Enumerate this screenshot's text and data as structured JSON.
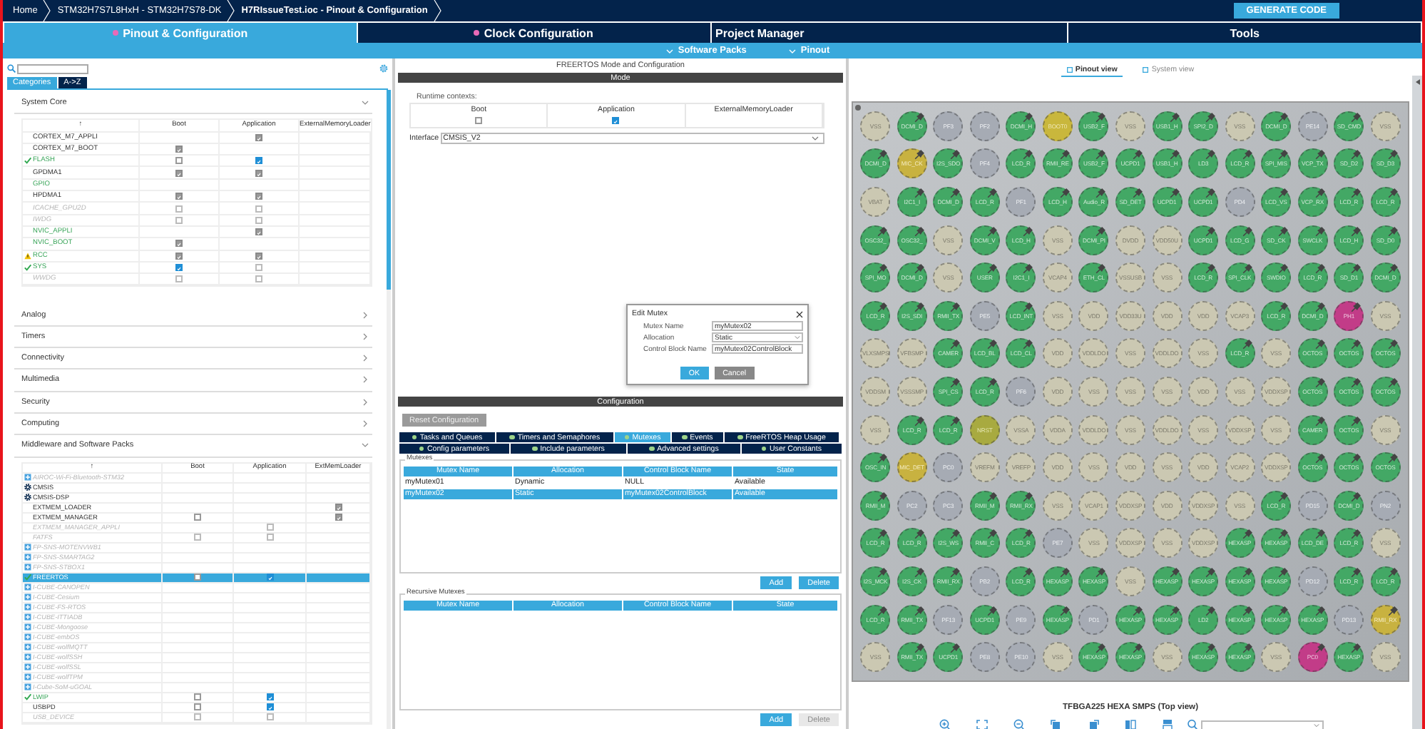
{
  "breadcrumbs": [
    "Home",
    "STM32H7S7L8HxH  -  STM32H7S78-DK",
    "H7RIssueTest.ioc - Pinout & Configuration"
  ],
  "generate_button": "GENERATE CODE",
  "tabs": [
    {
      "label": "Pinout & Configuration",
      "selected": true,
      "modified": true
    },
    {
      "label": "Clock Configuration",
      "selected": false,
      "modified": true
    },
    {
      "label": "Project Manager",
      "selected": false,
      "modified": false
    },
    {
      "label": "Tools",
      "selected": false,
      "modified": false
    }
  ],
  "menus": [
    "Software Packs",
    "Pinout"
  ],
  "sidebar": {
    "view_tabs": [
      {
        "label": "Categories",
        "selected": true
      },
      {
        "label": "A->Z",
        "selected": false
      }
    ],
    "groups": [
      {
        "title": "System Core",
        "expanded": true,
        "columns": [
          "↑",
          "Boot",
          "Application",
          "ExternalMemoryLoader"
        ],
        "rows": [
          {
            "name": "CORTEX_M7_APPLI",
            "kind": "available",
            "application": {
              "checked": true,
              "enabled": false
            }
          },
          {
            "name": "CORTEX_M7_BOOT",
            "kind": "available",
            "boot": {
              "checked": true,
              "enabled": false
            }
          },
          {
            "name": "FLASH",
            "kind": "ok",
            "boot": {
              "checked": false,
              "enabled": true
            },
            "application": {
              "checked": true,
              "enabled": true
            }
          },
          {
            "name": "GPDMA1",
            "kind": "available",
            "boot": {
              "checked": true,
              "enabled": false
            },
            "application": {
              "checked": true,
              "enabled": false
            }
          },
          {
            "name": "GPIO",
            "kind": "configured"
          },
          {
            "name": "HPDMA1",
            "kind": "available",
            "boot": {
              "checked": true,
              "enabled": false
            },
            "application": {
              "checked": true,
              "enabled": false
            }
          },
          {
            "name": "ICACHE_GPU2D",
            "kind": "unavailable",
            "boot": {
              "checked": false,
              "enabled": false
            },
            "application": {
              "checked": false,
              "enabled": false
            }
          },
          {
            "name": "IWDG",
            "kind": "unavailable",
            "boot": {
              "checked": false,
              "enabled": false
            },
            "application": {
              "checked": false,
              "enabled": false
            }
          },
          {
            "name": "NVIC_APPLI",
            "kind": "configured",
            "application": {
              "checked": true,
              "enabled": false
            }
          },
          {
            "name": "NVIC_BOOT",
            "kind": "configured",
            "boot": {
              "checked": true,
              "enabled": false
            }
          },
          {
            "name": "RCC",
            "kind": "warning",
            "boot": {
              "checked": true,
              "enabled": false
            },
            "application": {
              "checked": true,
              "enabled": false
            }
          },
          {
            "name": "SYS",
            "kind": "ok",
            "boot": {
              "checked": true,
              "enabled": true
            },
            "application": {
              "checked": false,
              "enabled": false
            }
          },
          {
            "name": "WWDG",
            "kind": "unavailable",
            "boot": {
              "checked": false,
              "enabled": false
            },
            "application": {
              "checked": false,
              "enabled": false
            }
          }
        ]
      },
      {
        "title": "Analog",
        "expanded": false
      },
      {
        "title": "Timers",
        "expanded": false
      },
      {
        "title": "Connectivity",
        "expanded": false
      },
      {
        "title": "Multimedia",
        "expanded": false
      },
      {
        "title": "Security",
        "expanded": false
      },
      {
        "title": "Computing",
        "expanded": false
      },
      {
        "title": "Middleware and Software Packs",
        "expanded": true,
        "columns": [
          "↑",
          "Boot",
          "Application",
          "ExtMemLoader"
        ],
        "rows": [
          {
            "name": "AIROC-Wi-Fi-Bluetooth-STM32",
            "kind": "pack",
            "selected": false
          },
          {
            "name": "CMSIS",
            "kind": "component",
            "selected": false
          },
          {
            "name": "CMSIS-DSP",
            "kind": "component",
            "selected": false
          },
          {
            "name": "EXTMEM_LOADER",
            "kind": "available",
            "selected": false,
            "ext": {
              "checked": true,
              "enabled": false
            }
          },
          {
            "name": "EXTMEM_MANAGER",
            "kind": "available",
            "selected": false,
            "boot": {
              "checked": false,
              "enabled": true
            },
            "ext": {
              "checked": true,
              "enabled": false
            }
          },
          {
            "name": "EXTMEM_MANAGER_APPLI",
            "kind": "unavailable",
            "selected": false,
            "application": {
              "checked": false,
              "enabled": false
            }
          },
          {
            "name": "FATFS",
            "kind": "unavailable",
            "selected": false,
            "boot": {
              "checked": false,
              "enabled": false
            },
            "application": {
              "checked": false,
              "enabled": false
            }
          },
          {
            "name": "FP-SNS-MOTENVWB1",
            "kind": "pack",
            "selected": false
          },
          {
            "name": "FP-SNS-SMARTAG2",
            "kind": "pack",
            "selected": false
          },
          {
            "name": "FP-SNS-STBOX1",
            "kind": "pack",
            "selected": false
          },
          {
            "name": "FREERTOS",
            "kind": "ok",
            "selected": true,
            "boot": {
              "checked": false,
              "enabled": true
            },
            "application": {
              "checked": true,
              "enabled": true
            }
          },
          {
            "name": "I-CUBE-CANOPEN",
            "kind": "pack",
            "selected": false
          },
          {
            "name": "I-CUBE-Cesium",
            "kind": "pack",
            "selected": false
          },
          {
            "name": "I-CUBE-FS-RTOS",
            "kind": "pack",
            "selected": false
          },
          {
            "name": "I-CUBE-ITTIADB",
            "kind": "pack",
            "selected": false
          },
          {
            "name": "I-CUBE-Mongoose",
            "kind": "pack",
            "selected": false
          },
          {
            "name": "I-CUBE-embOS",
            "kind": "pack",
            "selected": false
          },
          {
            "name": "I-CUBE-wolfMQTT",
            "kind": "pack",
            "selected": false
          },
          {
            "name": "I-CUBE-wolfSSH",
            "kind": "pack",
            "selected": false
          },
          {
            "name": "I-CUBE-wolfSSL",
            "kind": "pack",
            "selected": false
          },
          {
            "name": "I-CUBE-wolfTPM",
            "kind": "pack",
            "selected": false
          },
          {
            "name": "I-Cube-SoM-uGOAL",
            "kind": "pack",
            "selected": false
          },
          {
            "name": "LWIP",
            "kind": "ok",
            "selected": false,
            "boot": {
              "checked": false,
              "enabled": true
            },
            "application": {
              "checked": true,
              "enabled": true
            }
          },
          {
            "name": "USBPD",
            "kind": "available",
            "selected": false,
            "boot": {
              "checked": false,
              "enabled": true
            },
            "application": {
              "checked": true,
              "enabled": true
            }
          },
          {
            "name": "USB_DEVICE",
            "kind": "unavailable",
            "selected": false,
            "boot": {
              "checked": false,
              "enabled": false
            },
            "application": {
              "checked": false,
              "enabled": false
            }
          }
        ]
      }
    ]
  },
  "mode_panel": {
    "title": "FREERTOS Mode and Configuration",
    "section": "Mode",
    "runtime_label": "Runtime contexts:",
    "contexts": [
      {
        "label": "Boot",
        "checked": false
      },
      {
        "label": "Application",
        "checked": true
      },
      {
        "label": "ExternalMemoryLoader"
      }
    ],
    "interface": {
      "label": "Interface",
      "value": "CMSIS_V2"
    }
  },
  "dialog": {
    "title": "Edit Mutex",
    "fields": [
      {
        "label": "Mutex Name",
        "kind": "text",
        "value": "myMutex02"
      },
      {
        "label": "Allocation",
        "kind": "select",
        "value": "Static"
      },
      {
        "label": "Control Block Name",
        "kind": "text",
        "value": "myMutex02ControlBlock"
      }
    ],
    "buttons": [
      {
        "label": "OK",
        "kind": "primary"
      },
      {
        "label": "Cancel",
        "kind": "secondary"
      }
    ]
  },
  "config_panel": {
    "section": "Configuration",
    "reset_button": "Reset Configuration",
    "tab_rows": [
      [
        {
          "label": "Tasks and Queues",
          "selected": false
        },
        {
          "label": "Timers and Semaphores",
          "selected": false
        },
        {
          "label": "Mutexes",
          "selected": true
        },
        {
          "label": "Events",
          "selected": false
        },
        {
          "label": "FreeRTOS Heap Usage",
          "selected": false
        }
      ],
      [
        {
          "label": "Config parameters",
          "selected": false
        },
        {
          "label": "Include parameters",
          "selected": false
        },
        {
          "label": "Advanced settings",
          "selected": false
        },
        {
          "label": "User Constants",
          "selected": false
        }
      ]
    ],
    "tables": [
      {
        "title": "Mutexes",
        "columns": [
          "Mutex Name",
          "Allocation",
          "Control Block Name",
          "State"
        ],
        "rows": [
          {
            "cells": [
              "myMutex01",
              "Dynamic",
              "NULL",
              "Available"
            ],
            "selected": false
          },
          {
            "cells": [
              "myMutex02",
              "Static",
              "myMutex02ControlBlock",
              "Available"
            ],
            "selected": true
          }
        ],
        "buttons": [
          {
            "label": "Add",
            "disabled": false
          },
          {
            "label": "Delete",
            "disabled": false
          }
        ]
      },
      {
        "title": "Recursive Mutexes",
        "columns": [
          "Mutex Name",
          "Allocation",
          "Control Block Name",
          "State"
        ],
        "buttons": [
          {
            "label": "Add",
            "disabled": false
          },
          {
            "label": "Delete",
            "disabled": true
          }
        ]
      }
    ]
  },
  "pinout": {
    "view_tabs": [
      {
        "label": "Pinout view",
        "selected": true
      },
      {
        "label": "System view",
        "selected": false
      }
    ],
    "pins": [
      [
        {
          "label": "VSS",
          "kind": "power",
          "pinned": false
        },
        {
          "label": "DCMI_D",
          "kind": "signal",
          "pinned": true
        },
        {
          "label": "PF3",
          "kind": "io",
          "pinned": false
        },
        {
          "label": "PF2",
          "kind": "io",
          "pinned": false
        },
        {
          "label": "DCMI_H",
          "kind": "signal",
          "pinned": true
        },
        {
          "label": "BOOT0",
          "kind": "boot",
          "pinned": false
        },
        {
          "label": "USB2_F",
          "kind": "signal",
          "pinned": true
        },
        {
          "label": "VSS",
          "kind": "power",
          "pinned": false
        },
        {
          "label": "USB1_H",
          "kind": "signal",
          "pinned": true
        },
        {
          "label": "SPI2_D",
          "kind": "signal",
          "pinned": true
        },
        {
          "label": "VSS",
          "kind": "power",
          "pinned": false
        },
        {
          "label": "DCMI_D",
          "kind": "signal",
          "pinned": true
        },
        {
          "label": "PE14",
          "kind": "io",
          "pinned": false
        },
        {
          "label": "SD_CMD",
          "kind": "signal",
          "pinned": true
        },
        {
          "label": "VSS",
          "kind": "power",
          "pinned": false
        }
      ],
      [
        {
          "label": "DCMI_D",
          "kind": "signal",
          "pinned": true
        },
        {
          "label": "MIC_CK",
          "kind": "partial",
          "pinned": true
        },
        {
          "label": "I2S_SDO",
          "kind": "signal",
          "pinned": true
        },
        {
          "label": "PF4",
          "kind": "io",
          "pinned": false
        },
        {
          "label": "LCD_R",
          "kind": "signal",
          "pinned": true
        },
        {
          "label": "RMII_RE",
          "kind": "signal",
          "pinned": true
        },
        {
          "label": "USB2_F",
          "kind": "signal",
          "pinned": true
        },
        {
          "label": "UCPD1",
          "kind": "signal",
          "pinned": true
        },
        {
          "label": "USB1_H",
          "kind": "signal",
          "pinned": true
        },
        {
          "label": "LD3",
          "kind": "signal",
          "pinned": true
        },
        {
          "label": "LCD_R",
          "kind": "signal",
          "pinned": true
        },
        {
          "label": "SPI_MIS",
          "kind": "signal",
          "pinned": true
        },
        {
          "label": "VCP_TX",
          "kind": "signal",
          "pinned": true
        },
        {
          "label": "SD_D2",
          "kind": "signal",
          "pinned": true
        },
        {
          "label": "SD_D3",
          "kind": "signal",
          "pinned": true
        }
      ],
      [
        {
          "label": "VBAT",
          "kind": "power",
          "pinned": false
        },
        {
          "label": "I2C1_I",
          "kind": "signal",
          "pinned": true
        },
        {
          "label": "DCMI_D",
          "kind": "signal",
          "pinned": true
        },
        {
          "label": "LCD_R",
          "kind": "signal",
          "pinned": true
        },
        {
          "label": "PF1",
          "kind": "io",
          "pinned": false
        },
        {
          "label": "LCD_H",
          "kind": "signal",
          "pinned": true
        },
        {
          "label": "Audio_R",
          "kind": "signal",
          "pinned": true
        },
        {
          "label": "SD_DET",
          "kind": "signal",
          "pinned": true
        },
        {
          "label": "UCPD1",
          "kind": "signal",
          "pinned": true
        },
        {
          "label": "UCPD1",
          "kind": "signal",
          "pinned": true
        },
        {
          "label": "PD4",
          "kind": "io",
          "pinned": false
        },
        {
          "label": "LCD_VS",
          "kind": "signal",
          "pinned": true
        },
        {
          "label": "VCP_RX",
          "kind": "signal",
          "pinned": true
        },
        {
          "label": "LCD_R",
          "kind": "signal",
          "pinned": true
        },
        {
          "label": "LCD_R",
          "kind": "signal",
          "pinned": true
        }
      ],
      [
        {
          "label": "OSC32_",
          "kind": "signal",
          "pinned": true
        },
        {
          "label": "OSC32_",
          "kind": "signal",
          "pinned": true
        },
        {
          "label": "VSS",
          "kind": "power",
          "pinned": false
        },
        {
          "label": "DCMI_V",
          "kind": "signal",
          "pinned": true
        },
        {
          "label": "LCD_H",
          "kind": "signal",
          "pinned": true
        },
        {
          "label": "VSS",
          "kind": "power",
          "pinned": false
        },
        {
          "label": "DCMI_PI",
          "kind": "signal",
          "pinned": true
        },
        {
          "label": "DVDD",
          "kind": "power",
          "pinned": false
        },
        {
          "label": "VDD50U",
          "kind": "power",
          "pinned": false
        },
        {
          "label": "UCPD1",
          "kind": "signal",
          "pinned": true
        },
        {
          "label": "LCD_G",
          "kind": "signal",
          "pinned": true
        },
        {
          "label": "SD_CK",
          "kind": "signal",
          "pinned": true
        },
        {
          "label": "SWCLK",
          "kind": "signal",
          "pinned": true
        },
        {
          "label": "LCD_H",
          "kind": "signal",
          "pinned": true
        },
        {
          "label": "SD_D0",
          "kind": "signal",
          "pinned": true
        }
      ],
      [
        {
          "label": "SPI_MO",
          "kind": "signal",
          "pinned": true
        },
        {
          "label": "DCMI_D",
          "kind": "signal",
          "pinned": true
        },
        {
          "label": "VSS",
          "kind": "power",
          "pinned": false
        },
        {
          "label": "USER",
          "kind": "signal",
          "pinned": true
        },
        {
          "label": "I2C1_I",
          "kind": "signal",
          "pinned": true
        },
        {
          "label": "VCAP4",
          "kind": "power",
          "pinned": false
        },
        {
          "label": "ETH_CL",
          "kind": "signal",
          "pinned": true
        },
        {
          "label": "VSSUSB",
          "kind": "power",
          "pinned": false
        },
        {
          "label": "VSS",
          "kind": "power",
          "pinned": false
        },
        {
          "label": "LCD_R",
          "kind": "signal",
          "pinned": true
        },
        {
          "label": "SPI_CLK",
          "kind": "signal",
          "pinned": true
        },
        {
          "label": "SWDIO",
          "kind": "signal",
          "pinned": true
        },
        {
          "label": "LCD_R",
          "kind": "signal",
          "pinned": true
        },
        {
          "label": "SD_D1",
          "kind": "signal",
          "pinned": true
        },
        {
          "label": "DCMI_D",
          "kind": "signal",
          "pinned": true
        }
      ],
      [
        {
          "label": "LCD_R",
          "kind": "signal",
          "pinned": true
        },
        {
          "label": "I2S_SDI",
          "kind": "signal",
          "pinned": true
        },
        {
          "label": "RMII_TX",
          "kind": "signal",
          "pinned": true
        },
        {
          "label": "PE5",
          "kind": "io",
          "pinned": false
        },
        {
          "label": "LCD_INT",
          "kind": "signal",
          "pinned": true
        },
        {
          "label": "VSS",
          "kind": "power",
          "pinned": false
        },
        {
          "label": "VDD",
          "kind": "power",
          "pinned": false
        },
        {
          "label": "VDD33U",
          "kind": "power",
          "pinned": false
        },
        {
          "label": "VDD",
          "kind": "power",
          "pinned": false
        },
        {
          "label": "VDD",
          "kind": "power",
          "pinned": false
        },
        {
          "label": "VCAP3",
          "kind": "power",
          "pinned": false
        },
        {
          "label": "LCD_R",
          "kind": "signal",
          "pinned": true
        },
        {
          "label": "DCMI_D",
          "kind": "signal",
          "pinned": true
        },
        {
          "label": "PH1",
          "kind": "conflict",
          "pinned": true
        },
        {
          "label": "VSS",
          "kind": "power",
          "pinned": false
        }
      ],
      [
        {
          "label": "VLXSMPS",
          "kind": "power",
          "pinned": false
        },
        {
          "label": "VFBSMP",
          "kind": "power",
          "pinned": false
        },
        {
          "label": "CAMER",
          "kind": "signal",
          "pinned": true
        },
        {
          "label": "LCD_BL",
          "kind": "signal",
          "pinned": true
        },
        {
          "label": "LCD_CL",
          "kind": "signal",
          "pinned": true
        },
        {
          "label": "VDD",
          "kind": "power",
          "pinned": false
        },
        {
          "label": "VDDLDO",
          "kind": "power",
          "pinned": false
        },
        {
          "label": "VSS",
          "kind": "power",
          "pinned": false
        },
        {
          "label": "VDDLDO",
          "kind": "power",
          "pinned": false
        },
        {
          "label": "VSS",
          "kind": "power",
          "pinned": false
        },
        {
          "label": "LCD_R",
          "kind": "signal",
          "pinned": true
        },
        {
          "label": "VSS",
          "kind": "power",
          "pinned": false
        },
        {
          "label": "OCTOS",
          "kind": "signal",
          "pinned": true
        },
        {
          "label": "OCTOS",
          "kind": "signal",
          "pinned": true
        },
        {
          "label": "OCTOS",
          "kind": "signal",
          "pinned": true
        }
      ],
      [
        {
          "label": "VDDSM",
          "kind": "power",
          "pinned": false
        },
        {
          "label": "VSSSMP",
          "kind": "power",
          "pinned": false
        },
        {
          "label": "SPI_CS",
          "kind": "signal",
          "pinned": true
        },
        {
          "label": "LCD_R",
          "kind": "signal",
          "pinned": true
        },
        {
          "label": "PF6",
          "kind": "io",
          "pinned": false
        },
        {
          "label": "VDD",
          "kind": "power",
          "pinned": false
        },
        {
          "label": "VSS",
          "kind": "power",
          "pinned": false
        },
        {
          "label": "VSS",
          "kind": "power",
          "pinned": false
        },
        {
          "label": "VSS",
          "kind": "power",
          "pinned": false
        },
        {
          "label": "VDD",
          "kind": "power",
          "pinned": false
        },
        {
          "label": "VSS",
          "kind": "power",
          "pinned": false
        },
        {
          "label": "VDDXSP",
          "kind": "power",
          "pinned": false
        },
        {
          "label": "OCTOS",
          "kind": "signal",
          "pinned": true
        },
        {
          "label": "OCTOS",
          "kind": "signal",
          "pinned": true
        },
        {
          "label": "OCTOS",
          "kind": "signal",
          "pinned": true
        }
      ],
      [
        {
          "label": "VSS",
          "kind": "power",
          "pinned": false
        },
        {
          "label": "LCD_R",
          "kind": "signal",
          "pinned": true
        },
        {
          "label": "LCD_R",
          "kind": "signal",
          "pinned": true
        },
        {
          "label": "NRST",
          "kind": "reset",
          "pinned": false
        },
        {
          "label": "VSSA",
          "kind": "power",
          "pinned": false
        },
        {
          "label": "VDDA",
          "kind": "power",
          "pinned": false
        },
        {
          "label": "VDDLDO",
          "kind": "power",
          "pinned": false
        },
        {
          "label": "VSS",
          "kind": "power",
          "pinned": false
        },
        {
          "label": "VDDLDO",
          "kind": "power",
          "pinned": false
        },
        {
          "label": "VSS",
          "kind": "power",
          "pinned": false
        },
        {
          "label": "VDDXSP",
          "kind": "power",
          "pinned": false
        },
        {
          "label": "VSS",
          "kind": "power",
          "pinned": false
        },
        {
          "label": "CAMER",
          "kind": "signal",
          "pinned": true
        },
        {
          "label": "OCTOS",
          "kind": "signal",
          "pinned": true
        },
        {
          "label": "VSS",
          "kind": "power",
          "pinned": false
        }
      ],
      [
        {
          "label": "OSC_IN",
          "kind": "signal",
          "pinned": true
        },
        {
          "label": "MIC_DET",
          "kind": "partial",
          "pinned": false
        },
        {
          "label": "PC0",
          "kind": "io",
          "pinned": false
        },
        {
          "label": "VREFM",
          "kind": "power",
          "pinned": false
        },
        {
          "label": "VREFP",
          "kind": "power",
          "pinned": false
        },
        {
          "label": "VDD",
          "kind": "power",
          "pinned": false
        },
        {
          "label": "VSS",
          "kind": "power",
          "pinned": false
        },
        {
          "label": "VDD",
          "kind": "power",
          "pinned": false
        },
        {
          "label": "VSS",
          "kind": "power",
          "pinned": false
        },
        {
          "label": "VDD",
          "kind": "power",
          "pinned": false
        },
        {
          "label": "VCAP2",
          "kind": "power",
          "pinned": false
        },
        {
          "label": "VDDXSP",
          "kind": "power",
          "pinned": false
        },
        {
          "label": "OCTOS",
          "kind": "signal",
          "pinned": true
        },
        {
          "label": "OCTOS",
          "kind": "signal",
          "pinned": true
        },
        {
          "label": "OCTOS",
          "kind": "signal",
          "pinned": true
        }
      ],
      [
        {
          "label": "RMII_M",
          "kind": "signal",
          "pinned": true
        },
        {
          "label": "PC2",
          "kind": "io",
          "pinned": false
        },
        {
          "label": "PC3",
          "kind": "io",
          "pinned": false
        },
        {
          "label": "RMII_M",
          "kind": "signal",
          "pinned": true
        },
        {
          "label": "RMII_RX",
          "kind": "signal",
          "pinned": true
        },
        {
          "label": "VSS",
          "kind": "power",
          "pinned": false
        },
        {
          "label": "VCAP1",
          "kind": "power",
          "pinned": false
        },
        {
          "label": "VDDXSP",
          "kind": "power",
          "pinned": false
        },
        {
          "label": "VDD",
          "kind": "power",
          "pinned": false
        },
        {
          "label": "VDDXSP",
          "kind": "power",
          "pinned": false
        },
        {
          "label": "VSS",
          "kind": "power",
          "pinned": false
        },
        {
          "label": "LCD_R",
          "kind": "signal",
          "pinned": true
        },
        {
          "label": "PD15",
          "kind": "io",
          "pinned": false
        },
        {
          "label": "DCMI_D",
          "kind": "signal",
          "pinned": true
        },
        {
          "label": "PN2",
          "kind": "io",
          "pinned": false
        }
      ],
      [
        {
          "label": "LCD_R",
          "kind": "signal",
          "pinned": true
        },
        {
          "label": "LCD_R",
          "kind": "signal",
          "pinned": true
        },
        {
          "label": "I2S_WS",
          "kind": "signal",
          "pinned": true
        },
        {
          "label": "RMII_C",
          "kind": "signal",
          "pinned": true
        },
        {
          "label": "LCD_R",
          "kind": "signal",
          "pinned": true
        },
        {
          "label": "PE7",
          "kind": "io",
          "pinned": false
        },
        {
          "label": "VSS",
          "kind": "power",
          "pinned": false
        },
        {
          "label": "VDDXSP",
          "kind": "power",
          "pinned": false
        },
        {
          "label": "VSS",
          "kind": "power",
          "pinned": false
        },
        {
          "label": "VDDXSP",
          "kind": "power",
          "pinned": false
        },
        {
          "label": "HEXASP",
          "kind": "signal",
          "pinned": true
        },
        {
          "label": "HEXASP",
          "kind": "signal",
          "pinned": true
        },
        {
          "label": "LCD_DE",
          "kind": "signal",
          "pinned": true
        },
        {
          "label": "LCD_R",
          "kind": "signal",
          "pinned": true
        },
        {
          "label": "VSS",
          "kind": "power",
          "pinned": false
        }
      ],
      [
        {
          "label": "I2S_MCK",
          "kind": "signal",
          "pinned": true
        },
        {
          "label": "I2S_CK",
          "kind": "signal",
          "pinned": true
        },
        {
          "label": "RMII_RX",
          "kind": "signal",
          "pinned": true
        },
        {
          "label": "PB2",
          "kind": "io",
          "pinned": false
        },
        {
          "label": "LCD_R",
          "kind": "signal",
          "pinned": true
        },
        {
          "label": "HEXASP",
          "kind": "signal",
          "pinned": true
        },
        {
          "label": "HEXASP",
          "kind": "signal",
          "pinned": true
        },
        {
          "label": "VSS",
          "kind": "power",
          "pinned": false
        },
        {
          "label": "HEXASP",
          "kind": "signal",
          "pinned": true
        },
        {
          "label": "HEXASP",
          "kind": "signal",
          "pinned": true
        },
        {
          "label": "HEXASP",
          "kind": "signal",
          "pinned": true
        },
        {
          "label": "HEXASP",
          "kind": "signal",
          "pinned": true
        },
        {
          "label": "PD12",
          "kind": "io",
          "pinned": false
        },
        {
          "label": "LCD_R",
          "kind": "signal",
          "pinned": true
        },
        {
          "label": "LCD_R",
          "kind": "signal",
          "pinned": true
        }
      ],
      [
        {
          "label": "LCD_R",
          "kind": "signal",
          "pinned": true
        },
        {
          "label": "RMII_TX",
          "kind": "signal",
          "pinned": true
        },
        {
          "label": "PF13",
          "kind": "io",
          "pinned": false
        },
        {
          "label": "UCPD1",
          "kind": "signal",
          "pinned": true
        },
        {
          "label": "PE9",
          "kind": "io",
          "pinned": false
        },
        {
          "label": "HEXASP",
          "kind": "signal",
          "pinned": true
        },
        {
          "label": "PD1",
          "kind": "io",
          "pinned": false
        },
        {
          "label": "HEXASP",
          "kind": "signal",
          "pinned": true
        },
        {
          "label": "HEXASP",
          "kind": "signal",
          "pinned": true
        },
        {
          "label": "LD2",
          "kind": "signal",
          "pinned": true
        },
        {
          "label": "HEXASP",
          "kind": "signal",
          "pinned": true
        },
        {
          "label": "HEXASP",
          "kind": "signal",
          "pinned": true
        },
        {
          "label": "HEXASP",
          "kind": "signal",
          "pinned": true
        },
        {
          "label": "PD13",
          "kind": "io",
          "pinned": false
        },
        {
          "label": "RMII_RX",
          "kind": "partial",
          "pinned": true
        }
      ],
      [
        {
          "label": "VSS",
          "kind": "power",
          "pinned": false
        },
        {
          "label": "RMII_TX",
          "kind": "signal",
          "pinned": true
        },
        {
          "label": "UCPD1",
          "kind": "signal",
          "pinned": true
        },
        {
          "label": "PE8",
          "kind": "io",
          "pinned": false
        },
        {
          "label": "PE10",
          "kind": "io",
          "pinned": false
        },
        {
          "label": "VSS",
          "kind": "power",
          "pinned": false
        },
        {
          "label": "HEXASP",
          "kind": "signal",
          "pinned": true
        },
        {
          "label": "HEXASP",
          "kind": "signal",
          "pinned": true
        },
        {
          "label": "VSS",
          "kind": "power",
          "pinned": false
        },
        {
          "label": "HEXASP",
          "kind": "signal",
          "pinned": true
        },
        {
          "label": "HEXASP",
          "kind": "signal",
          "pinned": true
        },
        {
          "label": "VSS",
          "kind": "power",
          "pinned": false
        },
        {
          "label": "PC0",
          "kind": "conflict",
          "pinned": true
        },
        {
          "label": "HEXASP",
          "kind": "signal",
          "pinned": true
        },
        {
          "label": "VSS",
          "kind": "power",
          "pinned": false
        }
      ]
    ],
    "caption": "TFBGA225 HEXA SMPS (Top view)"
  }
}
